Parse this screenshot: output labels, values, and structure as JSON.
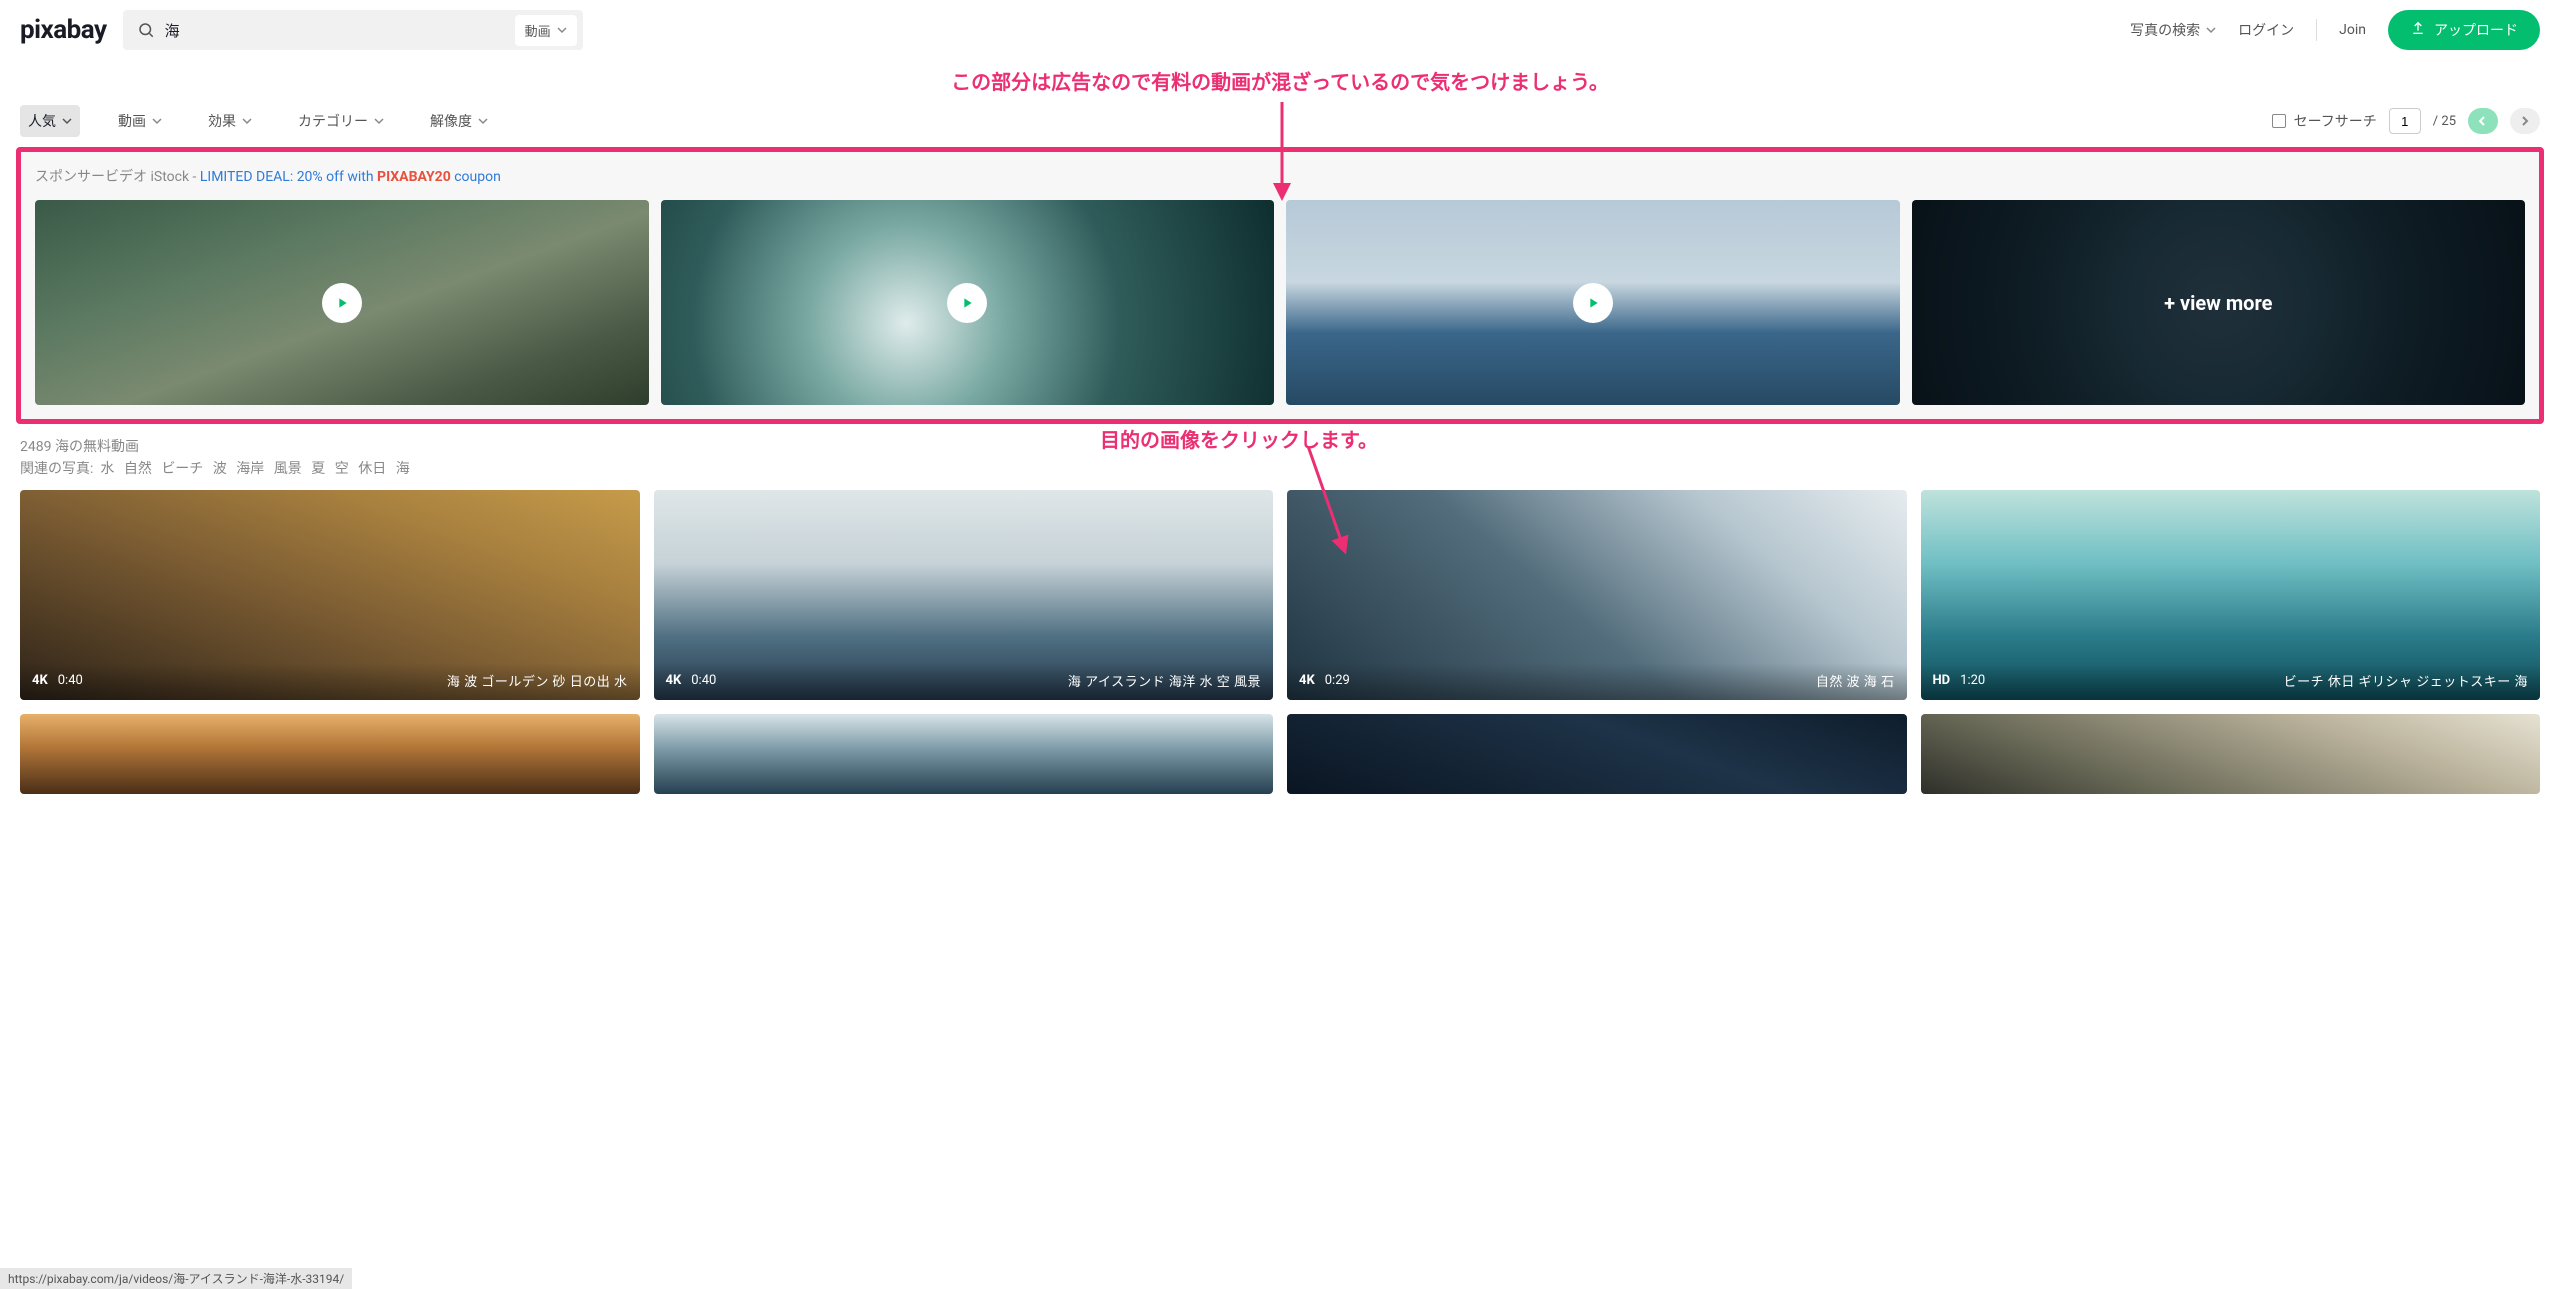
{
  "brand": "pixabay",
  "search": {
    "value": "海",
    "type_label": "動画"
  },
  "rightnav": {
    "explore": "写真の検索",
    "login": "ログイン",
    "join": "Join",
    "upload": "アップロード"
  },
  "annot1": "この部分は広告なので有料の動画が混ざっているので気をつけましょう。",
  "filters": {
    "sort": "人気",
    "video": "動画",
    "effect": "効果",
    "category": "カテゴリー",
    "resolution": "解像度"
  },
  "safesearch": "セーフサーチ",
  "page": {
    "current": "1",
    "total": "/ 25"
  },
  "sponsor": {
    "prefix": "スポンサービデオ iStock - ",
    "deal1": "LIMITED DEAL: 20% off with ",
    "code": "PIXABAY20",
    "deal2": " coupon",
    "viewmore": "+ view more"
  },
  "count_line": "2489 海の無料動画",
  "related_label": "関連の写真:",
  "related_keywords": [
    "水",
    "自然",
    "ビーチ",
    "波",
    "海岸",
    "風景",
    "夏",
    "空",
    "休日",
    "海"
  ],
  "annot2": "目的の画像をクリックします。",
  "results": [
    {
      "res": "4K",
      "dur": "0:40",
      "tags": "海  波  ゴールデン  砂  日の出  水"
    },
    {
      "res": "4K",
      "dur": "0:40",
      "tags": "海  アイスランド  海洋  水  空  風景"
    },
    {
      "res": "4K",
      "dur": "0:29",
      "tags": "自然  波  海  石"
    },
    {
      "res": "HD",
      "dur": "1:20",
      "tags": "ビーチ  休日  ギリシャ  ジェットスキー  海"
    }
  ],
  "status_url": "https://pixabay.com/ja/videos/海-アイスランド-海洋-水-33194/"
}
